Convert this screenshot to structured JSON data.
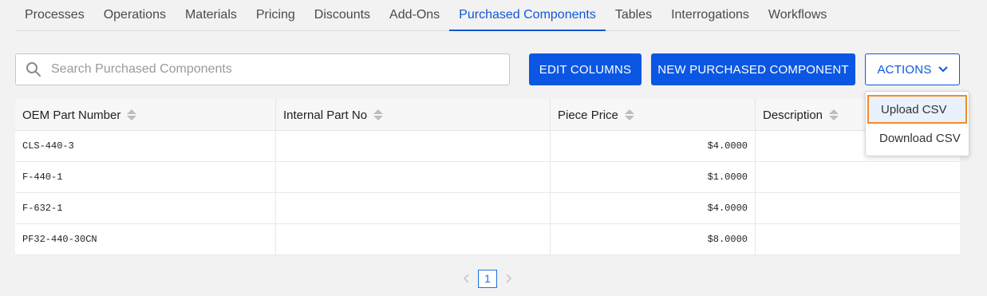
{
  "tabs": [
    {
      "label": "Processes",
      "active": false
    },
    {
      "label": "Operations",
      "active": false
    },
    {
      "label": "Materials",
      "active": false
    },
    {
      "label": "Pricing",
      "active": false
    },
    {
      "label": "Discounts",
      "active": false
    },
    {
      "label": "Add-Ons",
      "active": false
    },
    {
      "label": "Purchased Components",
      "active": true
    },
    {
      "label": "Tables",
      "active": false
    },
    {
      "label": "Interrogations",
      "active": false
    },
    {
      "label": "Workflows",
      "active": false
    }
  ],
  "search": {
    "placeholder": "Search Purchased Components",
    "value": "",
    "icon": "search-icon"
  },
  "toolbar": {
    "edit_columns_label": "EDIT COLUMNS",
    "new_component_label": "NEW PURCHASED COMPONENT",
    "actions_label": "ACTIONS"
  },
  "table": {
    "columns": [
      "OEM Part Number",
      "Internal Part No",
      "Piece Price",
      "Description"
    ],
    "rows": [
      [
        "CLS-440-3",
        "",
        "$4.0000",
        ""
      ],
      [
        "F-440-1",
        "",
        "$1.0000",
        ""
      ],
      [
        "F-632-1",
        "",
        "$4.0000",
        ""
      ],
      [
        "PF32-440-30CN",
        "",
        "$8.0000",
        ""
      ]
    ]
  },
  "pagination": {
    "current_page": "1"
  },
  "actions_menu": {
    "items": [
      "Upload CSV",
      "Download CSV"
    ],
    "highlighted": "Upload CSV"
  },
  "colors": {
    "primary": "#0b57e3",
    "active_tab": "#1157d6",
    "highlight_border": "#f28c28",
    "background": "#f2f2f2"
  }
}
